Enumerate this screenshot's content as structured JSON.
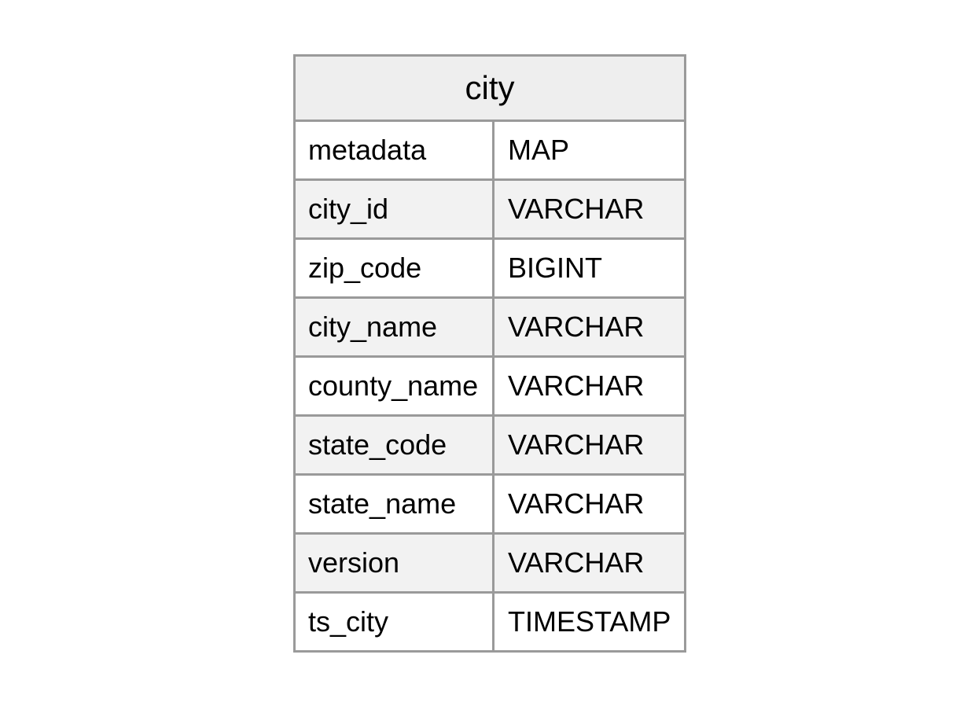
{
  "table": {
    "title": "city",
    "columns": [
      {
        "name": "metadata",
        "type": "MAP"
      },
      {
        "name": "city_id",
        "type": "VARCHAR"
      },
      {
        "name": "zip_code",
        "type": "BIGINT"
      },
      {
        "name": "city_name",
        "type": "VARCHAR"
      },
      {
        "name": "county_name",
        "type": "VARCHAR"
      },
      {
        "name": "state_code",
        "type": "VARCHAR"
      },
      {
        "name": "state_name",
        "type": "VARCHAR"
      },
      {
        "name": "version",
        "type": "VARCHAR"
      },
      {
        "name": "ts_city",
        "type": "TIMESTAMP"
      }
    ],
    "colors": {
      "border": "#9a9a9a",
      "header_bg": "#eeeeee",
      "alt_row_bg": "#f2f2f2"
    }
  }
}
